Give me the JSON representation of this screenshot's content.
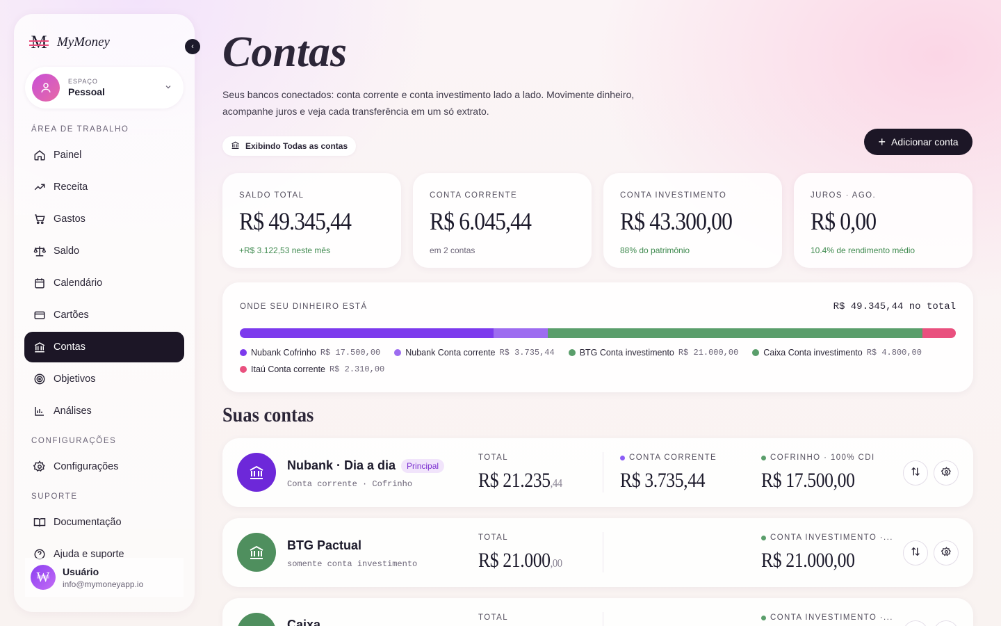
{
  "app": {
    "name": "MyMoney",
    "logo_glyph": "M"
  },
  "space": {
    "kicker": "ESPAÇO",
    "name": "Pessoal"
  },
  "sidebar": {
    "section_work": "ÁREA DE TRABALHO",
    "items": [
      {
        "label": "Painel",
        "icon": "home-icon"
      },
      {
        "label": "Receita",
        "icon": "trending-up-icon"
      },
      {
        "label": "Gastos",
        "icon": "cart-icon"
      },
      {
        "label": "Saldo",
        "icon": "scale-icon"
      },
      {
        "label": "Calendário",
        "icon": "calendar-icon"
      },
      {
        "label": "Cartões",
        "icon": "card-icon"
      },
      {
        "label": "Contas",
        "icon": "bank-icon",
        "active": true
      },
      {
        "label": "Objetivos",
        "icon": "target-icon"
      },
      {
        "label": "Análises",
        "icon": "bar-chart-icon"
      }
    ],
    "section_config": "CONFIGURAÇÕES",
    "config_item": "Configurações",
    "section_support": "SUPORTE",
    "support_items": [
      "Documentação",
      "Ajuda e suporte"
    ]
  },
  "user": {
    "name": "Usuário",
    "email": "info@mymoneyapp.io",
    "avatar_glyph": "₩"
  },
  "page": {
    "title": "Contas",
    "subtitle": "Seus bancos conectados: conta corrente e conta investimento lado a lado. Movimente dinheiro, acompanhe juros e veja cada transferência em um só extrato.",
    "filter_label": "Exibindo Todas as contas",
    "add_button": "Adicionar conta"
  },
  "summary": [
    {
      "kicker": "SALDO TOTAL",
      "value": "R$ 49.345,44",
      "sub": "+R$ 3.122,53 neste mês",
      "sub_green": true
    },
    {
      "kicker": "CONTA CORRENTE",
      "value": "R$ 6.045,44",
      "sub": "em 2 contas",
      "sub_green": false
    },
    {
      "kicker": "CONTA INVESTIMENTO",
      "value": "R$ 43.300,00",
      "sub": "88% do patrimônio",
      "sub_green": true
    },
    {
      "kicker": "JUROS · AGO.",
      "value": "R$ 0,00",
      "sub": "10.4% de rendimento médio",
      "sub_green": true
    }
  ],
  "allocation": {
    "kicker": "ONDE SEU DINHEIRO ESTÁ",
    "total": "R$ 49.345,44 no total",
    "segments": [
      {
        "label": "Nubank Cofrinho",
        "amount": "R$ 17.500,00",
        "value": 17500,
        "color": "#7c3aed"
      },
      {
        "label": "Nubank Conta corrente",
        "amount": "R$ 3.735,44",
        "value": 3735.44,
        "color": "#9d6cf0"
      },
      {
        "label": "BTG Conta investimento",
        "amount": "R$ 21.000,00",
        "value": 21000,
        "color": "#5a9e6b"
      },
      {
        "label": "Caixa Conta investimento",
        "amount": "R$ 4.800,00",
        "value": 4800,
        "color": "#5a9e6b"
      },
      {
        "label": "Itaú Conta corrente",
        "amount": "R$ 2.310,00",
        "value": 2310,
        "color": "#e9507e"
      }
    ]
  },
  "accounts_title": "Suas contas",
  "accounts": [
    {
      "name": "Nubank · Dia a dia",
      "badge": "Principal",
      "sub": "Conta corrente · Cofrinho",
      "logo_color": "#6d28d9",
      "total_k": "TOTAL",
      "total_main": "R$ 21.235",
      "total_cents": ",44",
      "c2_k": "CONTA CORRENTE",
      "c2_v": "R$ 3.735,44",
      "c2_dot": "#8b5cf6",
      "c3_k": "COFRINHO · 100% CDI",
      "c3_v": "R$ 17.500,00",
      "c3_dot": "#5a9e6b"
    },
    {
      "name": "BTG Pactual",
      "badge": "",
      "sub": "somente conta investimento",
      "logo_color": "#4f8f5e",
      "total_k": "TOTAL",
      "total_main": "R$ 21.000",
      "total_cents": ",00",
      "c2_k": "",
      "c2_v": "",
      "c2_dot": "",
      "c3_k": "CONTA INVESTIMENTO ·...",
      "c3_v": "R$ 21.000,00",
      "c3_dot": "#5a9e6b"
    },
    {
      "name": "Caixa",
      "badge": "",
      "sub": "",
      "logo_color": "#4f8f5e",
      "total_k": "TOTAL",
      "total_main": "",
      "total_cents": "",
      "c2_k": "",
      "c2_v": "",
      "c2_dot": "",
      "c3_k": "CONTA INVESTIMENTO ·...",
      "c3_v": "",
      "c3_dot": "#5a9e6b"
    }
  ],
  "icons": {
    "transfer": "transfer-icon",
    "settings": "gear-icon"
  }
}
